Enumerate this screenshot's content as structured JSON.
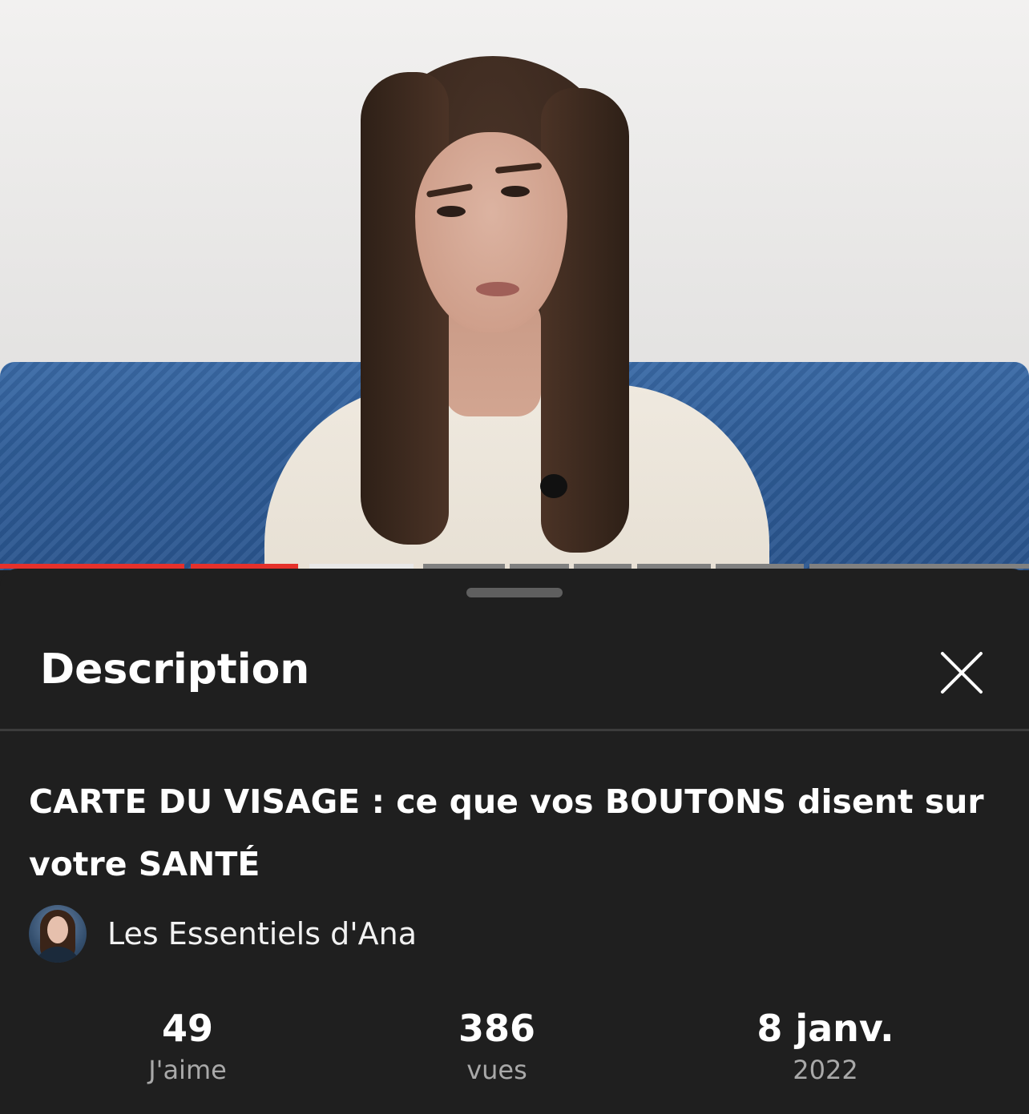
{
  "sheet": {
    "title": "Description",
    "close_icon": "close-icon"
  },
  "video": {
    "title": "CARTE DU VISAGE : ce que vos BOUTONS disent sur votre SANTÉ",
    "progress_played_fraction": 0.29
  },
  "channel": {
    "name": "Les Essentiels d'Ana",
    "avatar_icon": "avatar"
  },
  "stats": {
    "likes": {
      "value": "49",
      "label": "J'aime"
    },
    "views": {
      "value": "386",
      "label": "vues"
    },
    "date": {
      "value": "8 janv.",
      "label": "2022"
    }
  },
  "colors": {
    "progress_played": "#e5312b",
    "sheet_background": "#1f1f1f",
    "muted_text": "#a9a9a9"
  }
}
